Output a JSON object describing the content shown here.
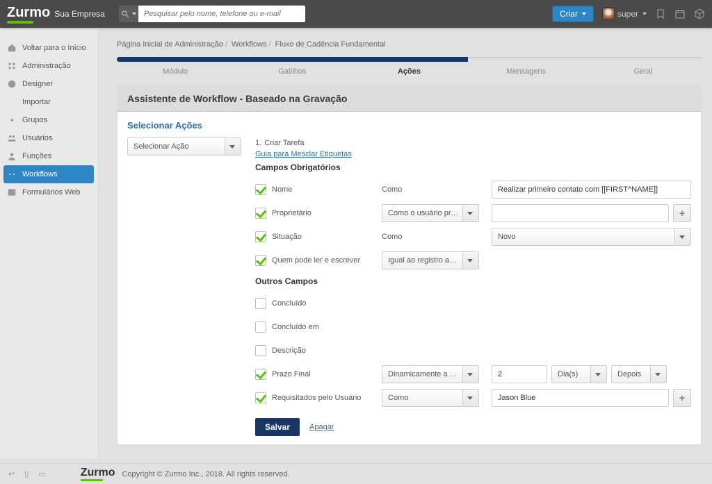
{
  "header": {
    "brand": "Zurmo",
    "subtitle": "Sua Empresa",
    "search_placeholder": "Pesquisar pelo nome, telefone ou e-mail",
    "create_label": "Criar",
    "user_label": "super"
  },
  "sidebar": {
    "items": [
      "Voltar para o Início",
      "Administração",
      "Designer",
      "Importar",
      "Grupos",
      "Usuários",
      "Funções",
      "Workflows",
      "Formulários Web"
    ],
    "active_index": 7
  },
  "breadcrumb": {
    "a": "Página Inicial de Administração",
    "b": "Workflows",
    "c": "Fluxo de Cadência Fundamental"
  },
  "steps": {
    "labels": [
      "Módulo",
      "Gatilhos",
      "Ações",
      "Mensagens",
      "Geral"
    ],
    "active_index": 2
  },
  "panel": {
    "title": "Assistente de Workflow - Baseado na Gravação",
    "section": "Selecionar Ações",
    "select_placeholder": "Selecionar Ação"
  },
  "rule": {
    "index": "1.",
    "title": "Criar Tarefa",
    "merge_link": "Guia para Mesclar Etiquetas",
    "required_header": "Campos Obrigatórios",
    "other_header": "Outros Campos",
    "fields": {
      "name": {
        "label": "Nome",
        "type": "Como",
        "value": "Realizar primeiro contato com [[FIRST^NAME]]"
      },
      "owner": {
        "label": "Proprietário",
        "type_select": "Como o usuário proprietário"
      },
      "status": {
        "label": "Situação",
        "type": "Como",
        "value_select": "Novo"
      },
      "perm": {
        "label": "Quem pode ler e escrever",
        "type_select": "Igual ao registro acionado"
      },
      "completed": {
        "label": "Concluído"
      },
      "completed_on": {
        "label": "Concluído em"
      },
      "description": {
        "label": "Descrição"
      },
      "due": {
        "label": "Prazo Final",
        "type_select": "Dinamicamente a partir de",
        "num": "2",
        "unit": "Dia(s)",
        "direction": "Depois"
      },
      "requested_by": {
        "label": "Requisitados pelo Usuário",
        "type_select": "Como",
        "value": "Jason Blue"
      }
    },
    "save": "Salvar",
    "delete": "Apagar"
  },
  "footer": {
    "brand": "Zurmo",
    "copyright": "Copyright © Zurmo Inc., 2018. All rights reserved."
  }
}
